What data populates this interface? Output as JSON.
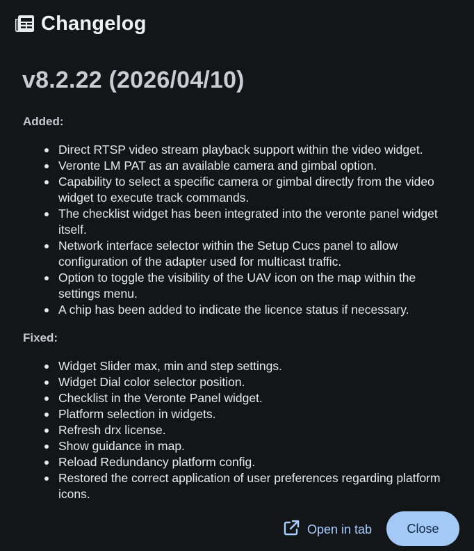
{
  "dialog": {
    "title": "Changelog",
    "icon": "changelog-list-icon"
  },
  "release": {
    "title": "v8.2.22 (2026/04/10)",
    "sections": [
      {
        "label": "Added:",
        "items": [
          "Direct RTSP video stream playback support within the video widget.",
          "Veronte LM PAT as an available camera and gimbal option.",
          "Capability to select a specific camera or gimbal directly from the video widget to execute track commands.",
          "The checklist widget has been integrated into the veronte panel widget itself.",
          "Network interface selector within the Setup Cucs panel to allow configuration of the adapter used for multicast traffic.",
          "Option to toggle the visibility of the UAV icon on the map within the settings menu.",
          "A chip has been added to indicate the licence status if necessary."
        ]
      },
      {
        "label": "Fixed:",
        "items": [
          "Widget Slider max, min and step settings.",
          "Widget Dial color selector position.",
          "Checklist in the Veronte Panel widget.",
          "Platform selection in widgets.",
          "Refresh drx license.",
          "Show guidance in map.",
          "Reload Redundancy platform config.",
          "Restored the correct application of user preferences regarding platform icons."
        ]
      }
    ]
  },
  "footer": {
    "open_in_tab_label": "Open in tab",
    "open_in_tab_icon": "external-link-icon",
    "close_label": "Close"
  },
  "colors": {
    "background": "#131619",
    "accent": "#a8cfff",
    "close_button_bg": "#a4c9f6"
  }
}
